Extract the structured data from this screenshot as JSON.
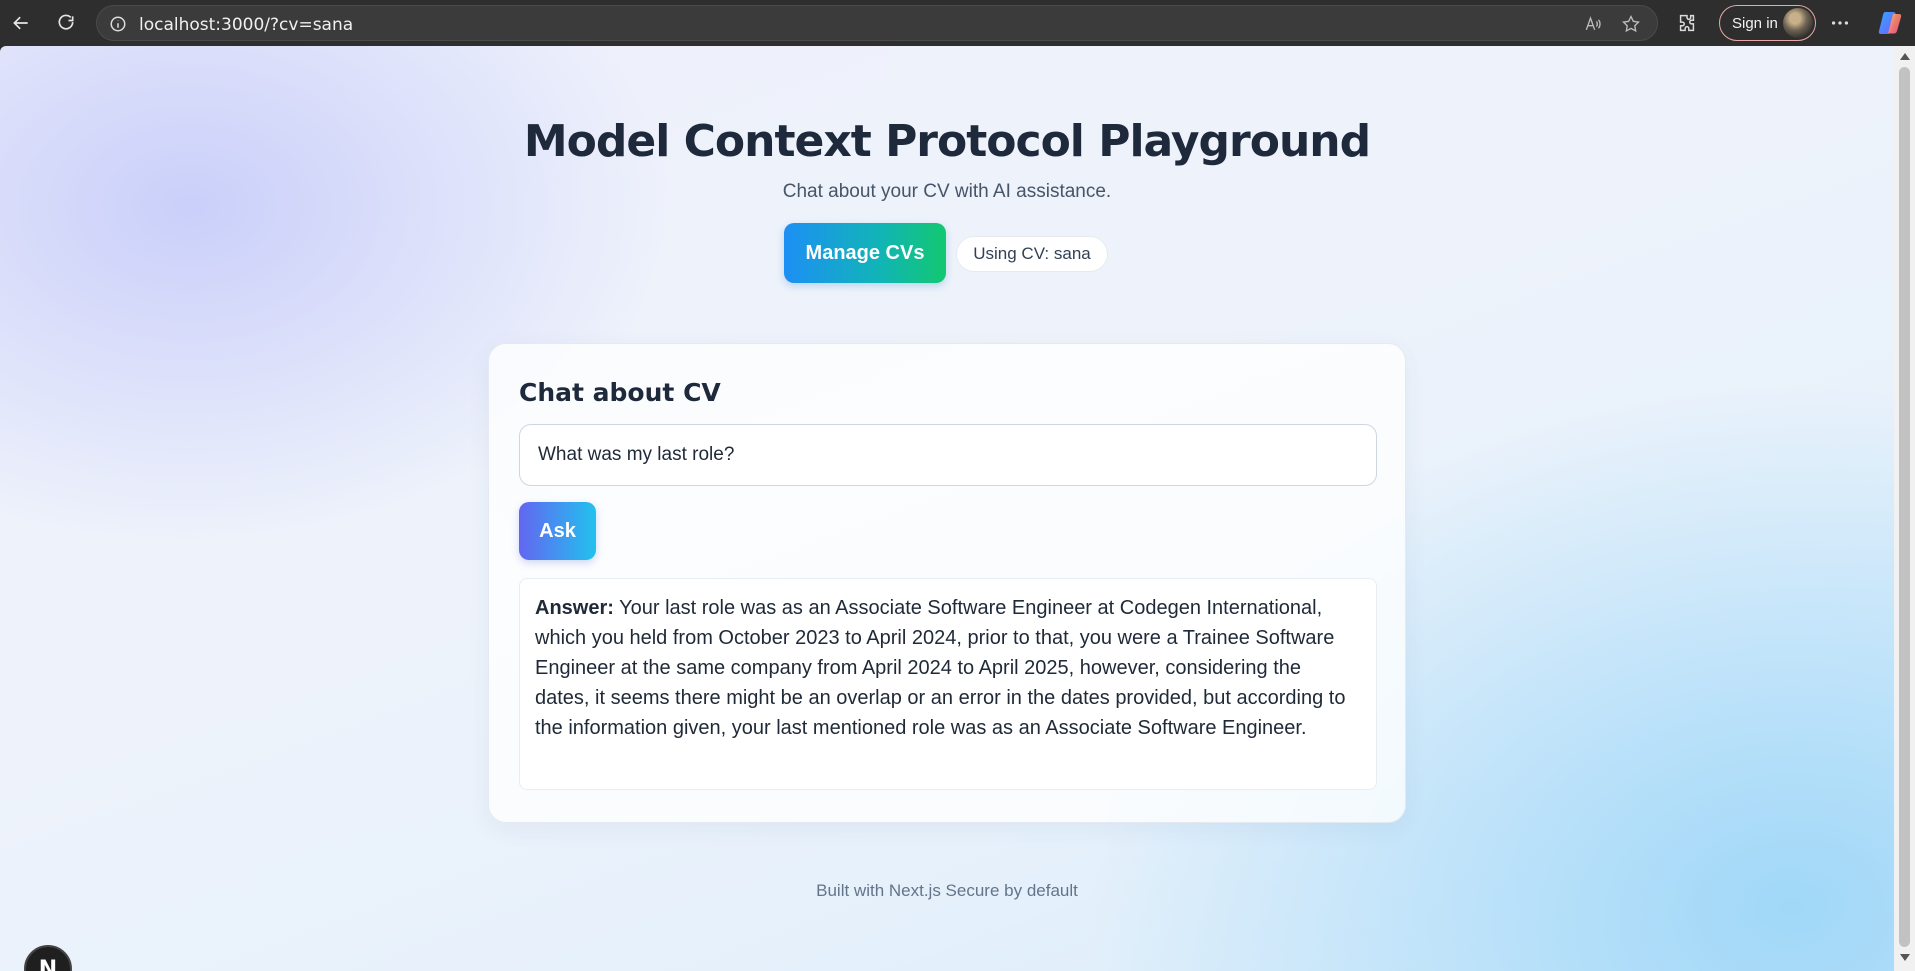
{
  "browser": {
    "url": "localhost:3000/?cv=sana",
    "signin_label": "Sign in"
  },
  "page": {
    "title": "Model Context Protocol Playground",
    "subtitle": "Chat about your CV with AI assistance.",
    "manage_button": "Manage CVs",
    "cv_badge": "Using CV: sana"
  },
  "chat": {
    "title": "Chat about CV",
    "input_value": "What was my last role?",
    "ask_button": "Ask",
    "answer_label": "Answer:",
    "answer_text": "Your last role was as an Associate Software Engineer at Codegen International, which you held from October 2023 to April 2024, prior to that, you were a Trainee Software Engineer at the same company from April 2024 to April 2025, however, considering the dates, it seems there might be an overlap or an error in the dates provided, but according to the information given, your last mentioned role was as an Associate Software Engineer."
  },
  "footer": {
    "text": "Built with Next.js Secure by default"
  },
  "next_badge": {
    "letter": "N"
  },
  "icons": [
    "back-icon",
    "refresh-icon",
    "info-icon",
    "read-aloud-icon",
    "favorite-star-icon",
    "extensions-icon",
    "more-icon",
    "copilot-icon"
  ]
}
